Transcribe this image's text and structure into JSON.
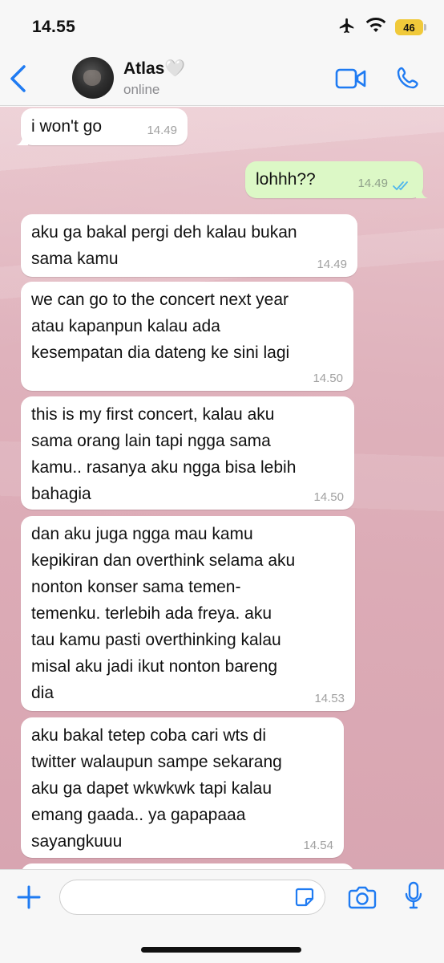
{
  "status_bar": {
    "time": "14.55",
    "battery": "46"
  },
  "header": {
    "contact_name": "Atlas🤍",
    "contact_status": "online"
  },
  "messages": [
    {
      "direction": "in",
      "text": "i won't go",
      "time": "14.49"
    },
    {
      "direction": "out",
      "text": "lohhh??",
      "time": "14.49",
      "status": "read"
    },
    {
      "direction": "in",
      "text": "aku ga bakal pergi deh kalau bukan\nsama kamu",
      "time": "14.49"
    },
    {
      "direction": "in",
      "text": "we can go to the concert next year\natau kapanpun kalau ada\nkesempatan dia dateng ke sini lagi",
      "time": "14.50"
    },
    {
      "direction": "in",
      "text": "this is my first concert, kalau aku\nsama orang lain tapi ngga sama\nkamu.. rasanya aku ngga bisa lebih\nbahagia",
      "time": "14.50"
    },
    {
      "direction": "in",
      "text": "dan aku juga ngga mau kamu\nkepikiran dan overthink selama aku\nnonton konser sama temen-\ntemenku. terlebih ada freya. aku\ntau kamu pasti overthinking kalau\nmisal aku jadi ikut nonton bareng\ndia",
      "time": "14.53"
    },
    {
      "direction": "in",
      "text": "aku bakal tetep coba cari wts di\ntwitter walaupun sampe sekarang\naku ga dapet wkwkwk tapi kalau\nemang gaada.. ya gapapaaa\nsayangkuuu",
      "time": "14.54"
    }
  ],
  "input": {
    "value": "",
    "placeholder": ""
  },
  "colors": {
    "accent": "#1f7bf2",
    "outgoing_bubble": "#dcf8c6",
    "incoming_bubble": "#ffffff",
    "read_ticks": "#4fb6ec"
  },
  "icons": [
    "back-icon",
    "video-call-icon",
    "phone-icon",
    "plus-icon",
    "sticker-icon",
    "camera-icon",
    "mic-icon",
    "airplane-icon",
    "wifi-icon"
  ]
}
